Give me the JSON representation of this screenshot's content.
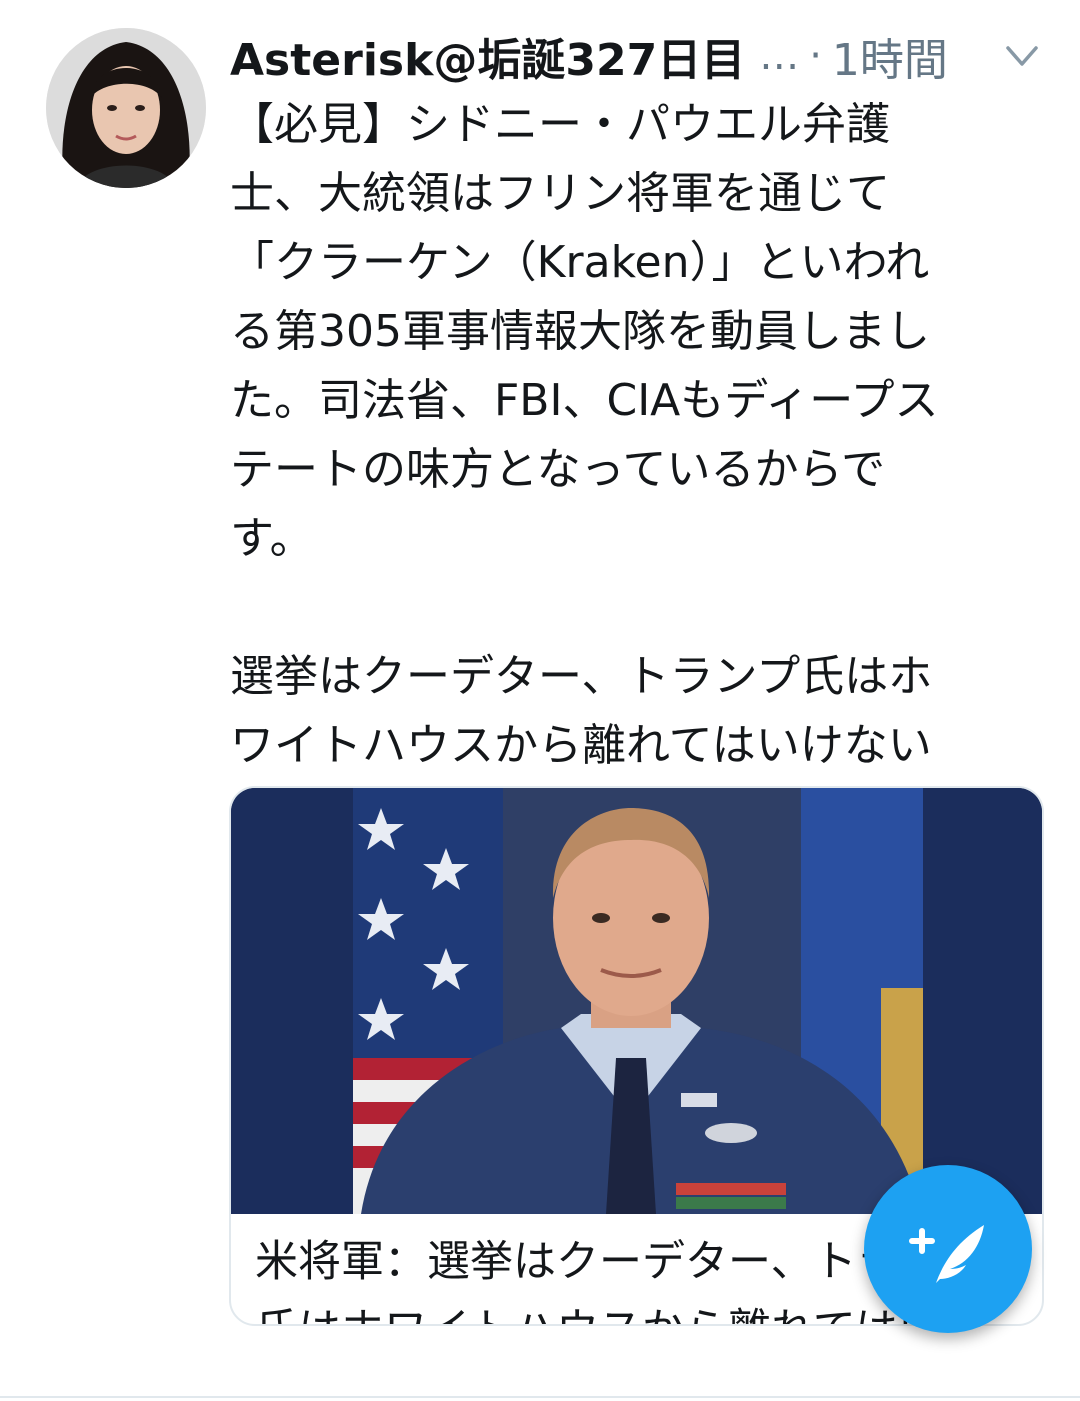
{
  "tweet": {
    "display_name": "Asterisk@垢誕327日目",
    "name_ellipsis": "…",
    "separator": "·",
    "time": "1時間",
    "text": "【必見】シドニー・パウエル弁護\n士、大統領はフリン将軍を通じて\n「クラーケン（Kraken）」といわれ\nる第305軍事情報大隊を動員しまし\nた。司法省、FBI、CIAもディープス\nテートの味方となっているからで\nす。\n\n選挙はクーデター、トランプ氏はホ\nワイトハウスから離れてはいけない"
  },
  "card": {
    "title": "米将軍：選挙はクーデター、トランプ氏はホワイトハウスから離れてはいけない"
  },
  "icons": {
    "caret": "chevron-down-icon",
    "compose": "compose-tweet-icon"
  },
  "colors": {
    "accent": "#1da1f2",
    "muted": "#657786",
    "text": "#14171a",
    "border": "#e1e8ed"
  }
}
